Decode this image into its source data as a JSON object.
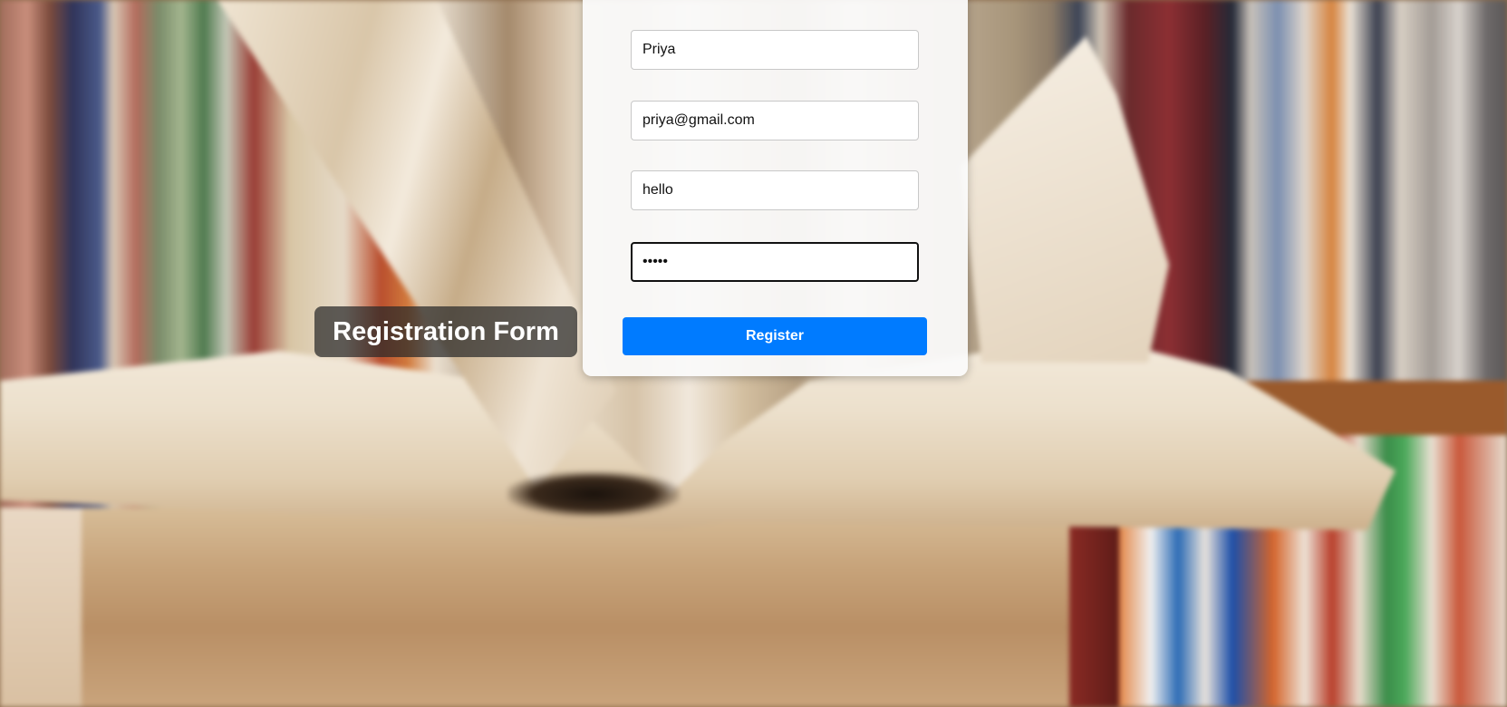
{
  "title": "Registration Form",
  "form": {
    "name_value": "Priya",
    "email_value": "priya@gmail.com",
    "username_value": "hello",
    "password_value": "hello",
    "register_label": "Register"
  },
  "colors": {
    "button": "#007bff",
    "button_text": "#ffffff",
    "title_bg": "#282828",
    "card_bg": "#fafafa"
  }
}
